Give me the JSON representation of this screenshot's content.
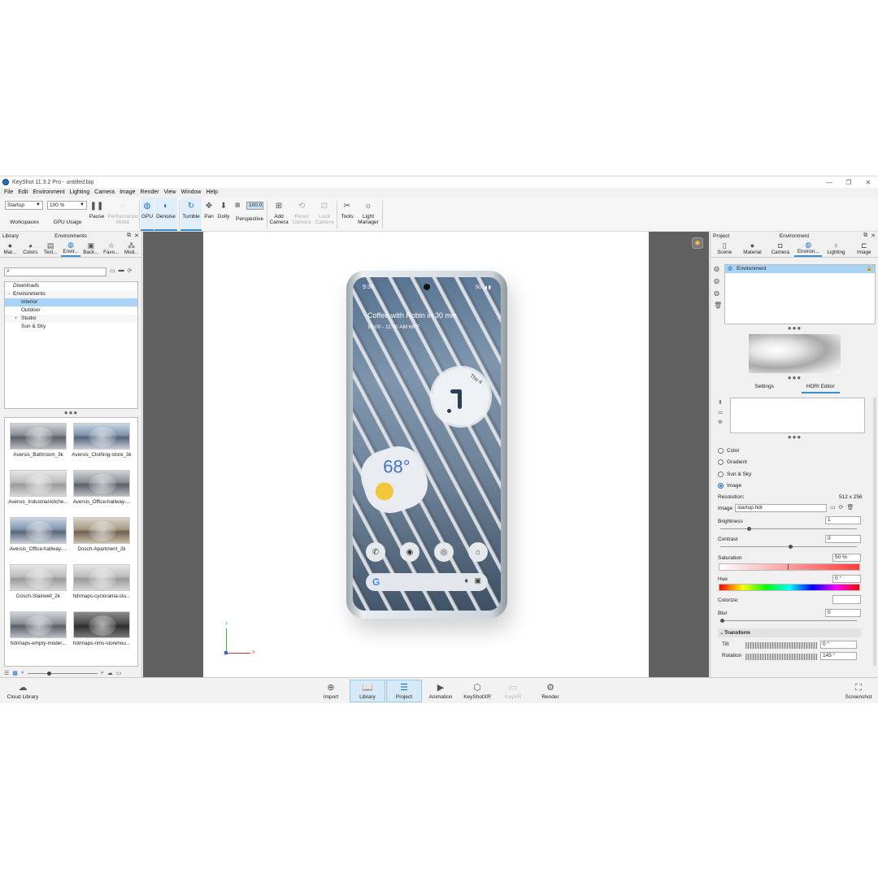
{
  "window": {
    "title": "KeyShot 11.3.2 Pro  -  untitled.bip",
    "minimize": "—",
    "maximize": "❐",
    "close": "✕"
  },
  "menu": [
    "File",
    "Edit",
    "Environment",
    "Lighting",
    "Camera",
    "Image",
    "Render",
    "View",
    "Window",
    "Help"
  ],
  "toolbar": {
    "workspace_select": "Startup",
    "cpu_select": "100 %",
    "workspaces": "Workspaces",
    "gpu_usage": "GPU Usage",
    "pause": "Pause",
    "performance_mode": "Performance\nMode",
    "gpu": "GPU",
    "denoise": "Denoise",
    "tumble": "Tumble",
    "pan": "Pan",
    "dolly": "Dolly",
    "perspective_value": "100.0",
    "perspective": "Perspective",
    "add_camera": "Add\nCamera",
    "reset_camera": "Reset\nCamera",
    "lock_camera": "Lock\nCamera",
    "tools": "Tools",
    "light_manager": "Light\nManager"
  },
  "library": {
    "panel_title": "Library",
    "section_title": "Environments",
    "tabs": [
      "Mat...",
      "Colors",
      "Text...",
      "Envir...",
      "Back...",
      "Favo...",
      "Mod..."
    ],
    "tree": [
      {
        "label": "Downloads",
        "italic": true
      },
      {
        "label": "Environments",
        "expand": "−"
      },
      {
        "label": "Interior",
        "selected": true
      },
      {
        "label": "Outdoor"
      },
      {
        "label": "Studio",
        "expand": "+"
      },
      {
        "label": "Sun & Sky"
      }
    ],
    "thumbnails": [
      "Aversis_Bathroom_3k",
      "Aversis_Clothing-store_3k",
      "Aversis_Industrial-kitche...",
      "Aversis_Office-hallway-...",
      "Aversis_Office-hallway-...",
      "Dosch-Apartment_2k",
      "Dosch-Stairwell_2k",
      "hdrmaps-cyclorama-stu...",
      "hdrmaps-empty-moder...",
      "hdrmaps-rims-storehou..."
    ]
  },
  "phone_screen": {
    "time": "9:30",
    "status": "5G ◢ ▮",
    "event": "Coffee with Robin in 30 min",
    "event_detail": "10:00 - 11:00 AM   68°F",
    "clock_day": "Thu 4",
    "weather_temp": "68°",
    "search_logo": "G"
  },
  "axes": {
    "x": "X",
    "y": "Y"
  },
  "project": {
    "panel_title": "Project",
    "section_title": "Environment",
    "tabs": [
      "Scene",
      "Material",
      "Camera",
      "Environ...",
      "Lighting",
      "Image"
    ],
    "env_item": "Environment",
    "subtabs": [
      "Settings",
      "HDRI Editor"
    ],
    "background_options": [
      "Color",
      "Gradient",
      "Sun & Sky",
      "Image"
    ],
    "resolution_label": "Resolution:",
    "resolution_value": "512 x 256",
    "image_label": "Image",
    "image_value": "startup.hdr",
    "brightness_label": "Brightness",
    "brightness_value": "1",
    "contrast_label": "Contrast",
    "contrast_value": "0",
    "saturation_label": "Saturation",
    "saturation_value": "50 %",
    "hue_label": "Hue",
    "hue_value": "0 °",
    "colorize_label": "Colorize:",
    "blur_label": "Blur",
    "blur_value": "0",
    "transform_label": "Transform",
    "tilt_label": "Tilt",
    "tilt_value": "0 °",
    "rotation_label": "Rotation",
    "rotation_value": "145 °"
  },
  "bottom": {
    "cloud_library": "Cloud Library",
    "import": "Import",
    "library": "Library",
    "project": "Project",
    "animation": "Animation",
    "keyshotxr": "KeyShotXR",
    "keyvr": "KeyVR",
    "render": "Render",
    "screenshot": "Screenshot"
  },
  "colors": {
    "accent": "#3c8dc9",
    "selection": "#a9d3f5",
    "viewport_bg": "#606060"
  }
}
